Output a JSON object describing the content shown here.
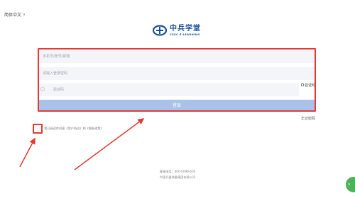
{
  "header": {
    "language": "简体中文"
  },
  "brand": {
    "cn": "中兵学堂",
    "en": "CSSC E-LEARNING",
    "color": "#1a4f9c"
  },
  "form": {
    "account_placeholder": "手机号/账号/邮箱",
    "password_placeholder": "请输入登录密码",
    "captcha_placeholder": "验证码",
    "captcha_alt": "验证码",
    "login_label": "登录",
    "forgot_label": "忘记密码",
    "frame_color": "#e53935",
    "button_color": "#a8c2ea"
  },
  "agreement": {
    "text": "我已阅读并同意《用户协议》和《隐私政策》"
  },
  "footer": {
    "line1": "客服电话：400-0099-600",
    "line2": "中国兵器装备集团有限公司"
  }
}
